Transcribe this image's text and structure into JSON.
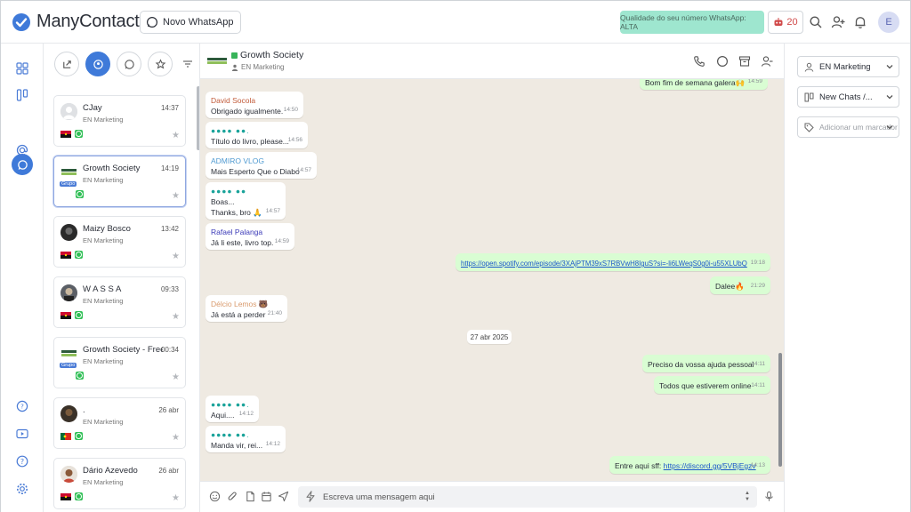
{
  "app": {
    "name": "ManyContacts"
  },
  "header": {
    "new_whatsapp_label": "Novo WhatsApp",
    "quality_label": "Qualidade do seu número WhatsApp: ALTA",
    "credits_count": "20",
    "user_initial": "E"
  },
  "chat_list": [
    {
      "name": "CJay",
      "time": "14:37",
      "team": "EN Marketing",
      "flag": "angola",
      "group": false,
      "selected": false,
      "avatar": "default"
    },
    {
      "name": "Growth Society",
      "time": "14:19",
      "team": "EN Marketing",
      "flag": "",
      "group": true,
      "group_label": "Grupo",
      "selected": true,
      "avatar": "logo"
    },
    {
      "name": "Maizy Bosco",
      "time": "13:42",
      "team": "EN Marketing",
      "flag": "angola",
      "group": false,
      "selected": false,
      "avatar": "dark"
    },
    {
      "name": "W A S S A",
      "time": "09:33",
      "team": "EN Marketing",
      "flag": "angola",
      "group": false,
      "selected": false,
      "avatar": "photo"
    },
    {
      "name": "Growth Society - Free",
      "time": "00:34",
      "team": "EN Marketing",
      "flag": "",
      "group": true,
      "group_label": "Grupo",
      "selected": false,
      "avatar": "logo"
    },
    {
      "name": ".",
      "time": "26 abr",
      "team": "EN Marketing",
      "flag": "portugal",
      "group": false,
      "selected": false,
      "avatar": "dark"
    },
    {
      "name": "Dário Azevedo",
      "time": "26 abr",
      "team": "EN Marketing",
      "flag": "angola",
      "group": false,
      "selected": false,
      "avatar": "person"
    }
  ],
  "conversation": {
    "title": "Growth Society",
    "team": "EN Marketing",
    "date_separator": "27 abr 2025",
    "messages": [
      {
        "dir": "out",
        "sender": "",
        "text": "Bom fim de semana galera🙌",
        "time": "14:59"
      },
      {
        "dir": "in",
        "sender": "David Socola",
        "text": "Obrigado igualmente.",
        "time": "14:50"
      },
      {
        "dir": "in",
        "sender": "●●●● ●●.",
        "text": "Título do livro, please...",
        "time": "14:56"
      },
      {
        "dir": "in",
        "sender": "ADMIRO VLOG",
        "text": "Mais Esperto Que o Diabo",
        "time": "14:57"
      },
      {
        "dir": "in",
        "sender": "●●●● ●●",
        "text": "Boas...",
        "text2": "Thanks, bro 🙏",
        "time": "14:57"
      },
      {
        "dir": "in",
        "sender": "Rafael Palanga",
        "text": "Já li este, livro top.",
        "time": "14:59"
      },
      {
        "dir": "out",
        "sender": "",
        "text": "https://open.spotify.com/episode/3XAjPTM39xS7RBVwH8IguS?si=-li6LWeqS0g0i-u55XLUbQ",
        "time": "19:18"
      },
      {
        "dir": "out",
        "sender": "",
        "text": "Dalee🔥",
        "time": "21:29"
      },
      {
        "dir": "in",
        "sender": "Délcio Lemos 🐻",
        "text": "Já está a perder",
        "time": "21:40"
      },
      {
        "dir": "out",
        "sender": "",
        "text": "Preciso da vossa ajuda pessoal",
        "time": "14:11"
      },
      {
        "dir": "out",
        "sender": "",
        "text": "Todos que estiverem online",
        "time": "14:11"
      },
      {
        "dir": "in",
        "sender": "●●●● ●●.",
        "text": "Aqui....",
        "time": "14:12"
      },
      {
        "dir": "in",
        "sender": "●●●● ●●.",
        "text": "Manda vir, rei...",
        "time": "14:12"
      },
      {
        "dir": "out",
        "sender": "",
        "text": "Entre aqui sff:",
        "link": "https://discord.gg/5VBjEgzv",
        "time": "14:13"
      }
    ]
  },
  "composer": {
    "placeholder": "Escreva uma mensagem aqui"
  },
  "right_panel": {
    "team_select": "EN Marketing",
    "stage_select": "New Chats /...",
    "tag_placeholder": "Adicionar um marcador"
  },
  "colors": {
    "primary": "#3f7ad9",
    "quality_bg": "#9ee6cf",
    "outgoing_bubble": "#d9fdd3",
    "chat_bg": "#efeae2"
  }
}
